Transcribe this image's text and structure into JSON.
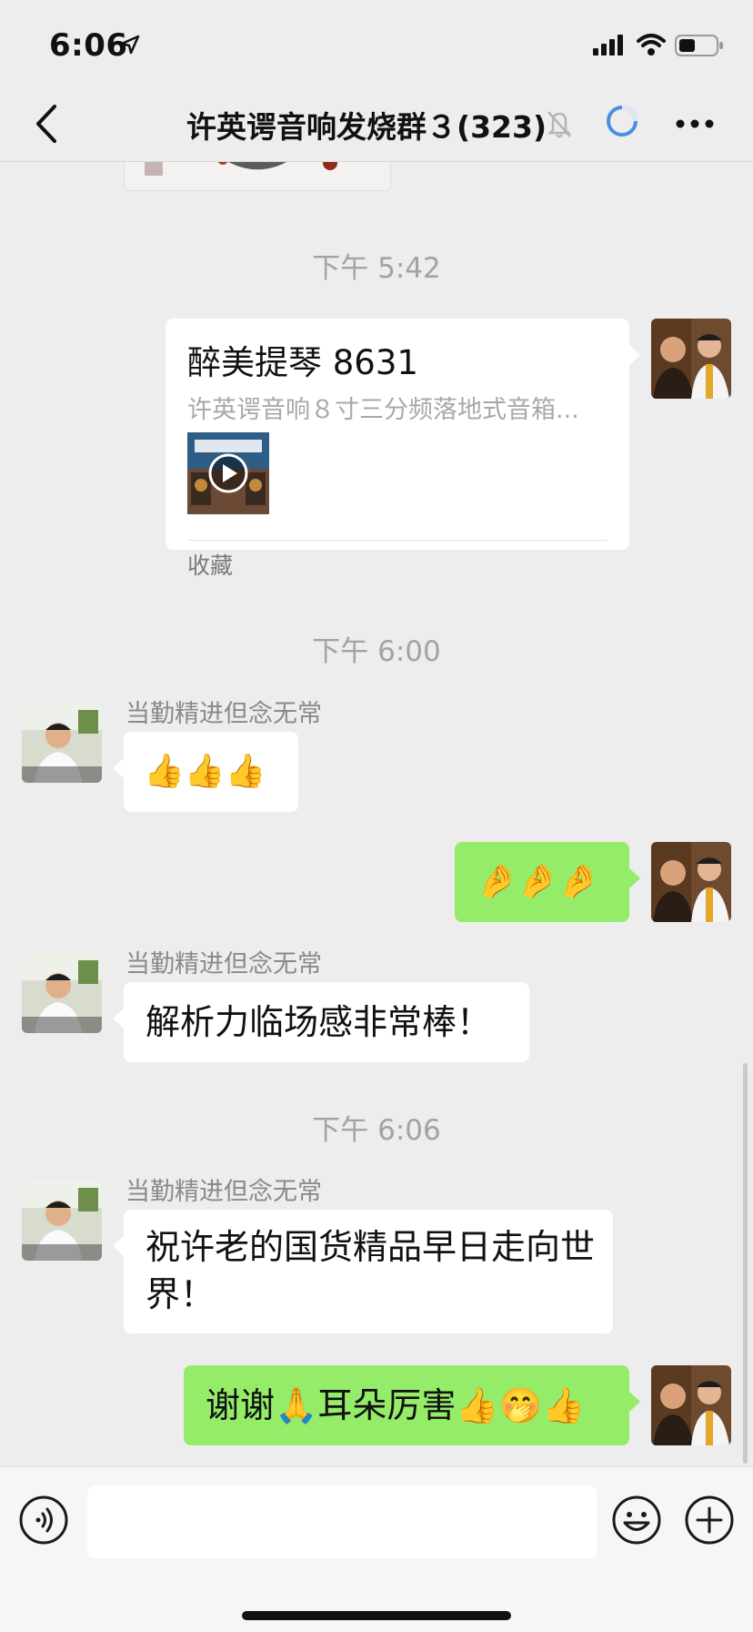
{
  "status_bar": {
    "time": "6:06"
  },
  "nav": {
    "title": "许英谔音响发烧群３(323)"
  },
  "chat": {
    "timestamps": [
      "下午 5:42",
      "下午 6:00",
      "下午 6:06"
    ],
    "card": {
      "title": "醉美提琴 8631",
      "description": "许英谔音响８寸三分频落地式音箱...",
      "footer": "收藏"
    },
    "sender_name": "当勤精进但念无常",
    "messages": {
      "thumbs": "👍👍👍",
      "pinched": "🤌🤌🤌",
      "praise": "解析力临场感非常棒！",
      "wish": "祝许老的国货精品早日走向世界！",
      "thanks": "谢谢🙏耳朵厉害👍🤭👍"
    }
  },
  "input": {
    "placeholder": ""
  },
  "colors": {
    "background": "#ededed",
    "bubble_green": "#95ec69",
    "bubble_white": "#ffffff",
    "accent_blue": "#4a90e2"
  }
}
